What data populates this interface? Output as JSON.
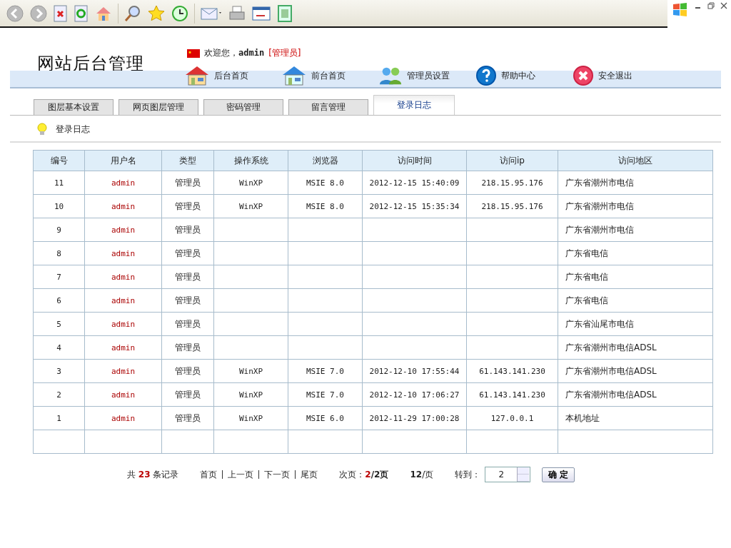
{
  "site_title": "网站后台管理",
  "welcome": {
    "text": "欢迎您，",
    "user": "admin",
    "role": "[管理员]"
  },
  "nav": [
    {
      "label": "后台首页",
      "kind": "house-red"
    },
    {
      "label": "前台首页",
      "kind": "house-blue"
    },
    {
      "label": "管理员设置",
      "kind": "users"
    },
    {
      "label": "帮助中心",
      "kind": "help"
    },
    {
      "label": "安全退出",
      "kind": "exit"
    }
  ],
  "tabs": [
    {
      "label": "图层基本设置",
      "selected": false
    },
    {
      "label": "网页图层管理",
      "selected": false
    },
    {
      "label": "密码管理",
      "selected": false
    },
    {
      "label": "留言管理",
      "selected": false
    },
    {
      "label": "登录日志",
      "selected": true
    }
  ],
  "breadcrumb": "登录日志",
  "table": {
    "columns": [
      "编号",
      "用户名",
      "类型",
      "操作系统",
      "浏览器",
      "访问时间",
      "访问ip",
      "访问地区"
    ],
    "rows": [
      {
        "id": "11",
        "user": "admin",
        "type": "管理员",
        "os": "WinXP",
        "browser": "MSIE 8.0",
        "time": "2012-12-15 15:40:09",
        "ip": "218.15.95.176",
        "region": "广东省潮州市电信"
      },
      {
        "id": "10",
        "user": "admin",
        "type": "管理员",
        "os": "WinXP",
        "browser": "MSIE 8.0",
        "time": "2012-12-15 15:35:34",
        "ip": "218.15.95.176",
        "region": "广东省潮州市电信"
      },
      {
        "id": "9",
        "user": "admin",
        "type": "管理员",
        "region": "广东省潮州市电信"
      },
      {
        "id": "8",
        "user": "admin",
        "type": "管理员",
        "region": "广东省电信"
      },
      {
        "id": "7",
        "user": "admin",
        "type": "管理员",
        "region": "广东省电信"
      },
      {
        "id": "6",
        "user": "admin",
        "type": "管理员",
        "region": "广东省电信"
      },
      {
        "id": "5",
        "user": "admin",
        "type": "管理员",
        "region": "广东省汕尾市电信"
      },
      {
        "id": "4",
        "user": "admin",
        "type": "管理员",
        "region": "广东省潮州市电信ADSL"
      },
      {
        "id": "3",
        "user": "admin",
        "type": "管理员",
        "os": "WinXP",
        "browser": "MSIE 7.0",
        "time": "2012-12-10 17:55:44",
        "ip": "61.143.141.230",
        "region": "广东省潮州市电信ADSL"
      },
      {
        "id": "2",
        "user": "admin",
        "type": "管理员",
        "os": "WinXP",
        "browser": "MSIE 7.0",
        "time": "2012-12-10 17:06:27",
        "ip": "61.143.141.230",
        "region": "广东省潮州市电信ADSL"
      },
      {
        "id": "1",
        "user": "admin",
        "type": "管理员",
        "os": "WinXP",
        "browser": "MSIE 6.0",
        "time": "2012-11-29 17:00:28",
        "ip": "127.0.0.1",
        "region": "本机地址"
      }
    ]
  },
  "pager": {
    "total_prefix": "共",
    "total": "23",
    "total_suffix": "条记录",
    "links": [
      "首页",
      "上一页",
      "下一页",
      "尾页"
    ],
    "page_label": "次页：",
    "page_current": "2",
    "page_rest": "/2页",
    "per_page_num": "12",
    "per_page_unit": "/页",
    "goto_label": "转到：",
    "goto_value": "2",
    "confirm": "确 定"
  }
}
